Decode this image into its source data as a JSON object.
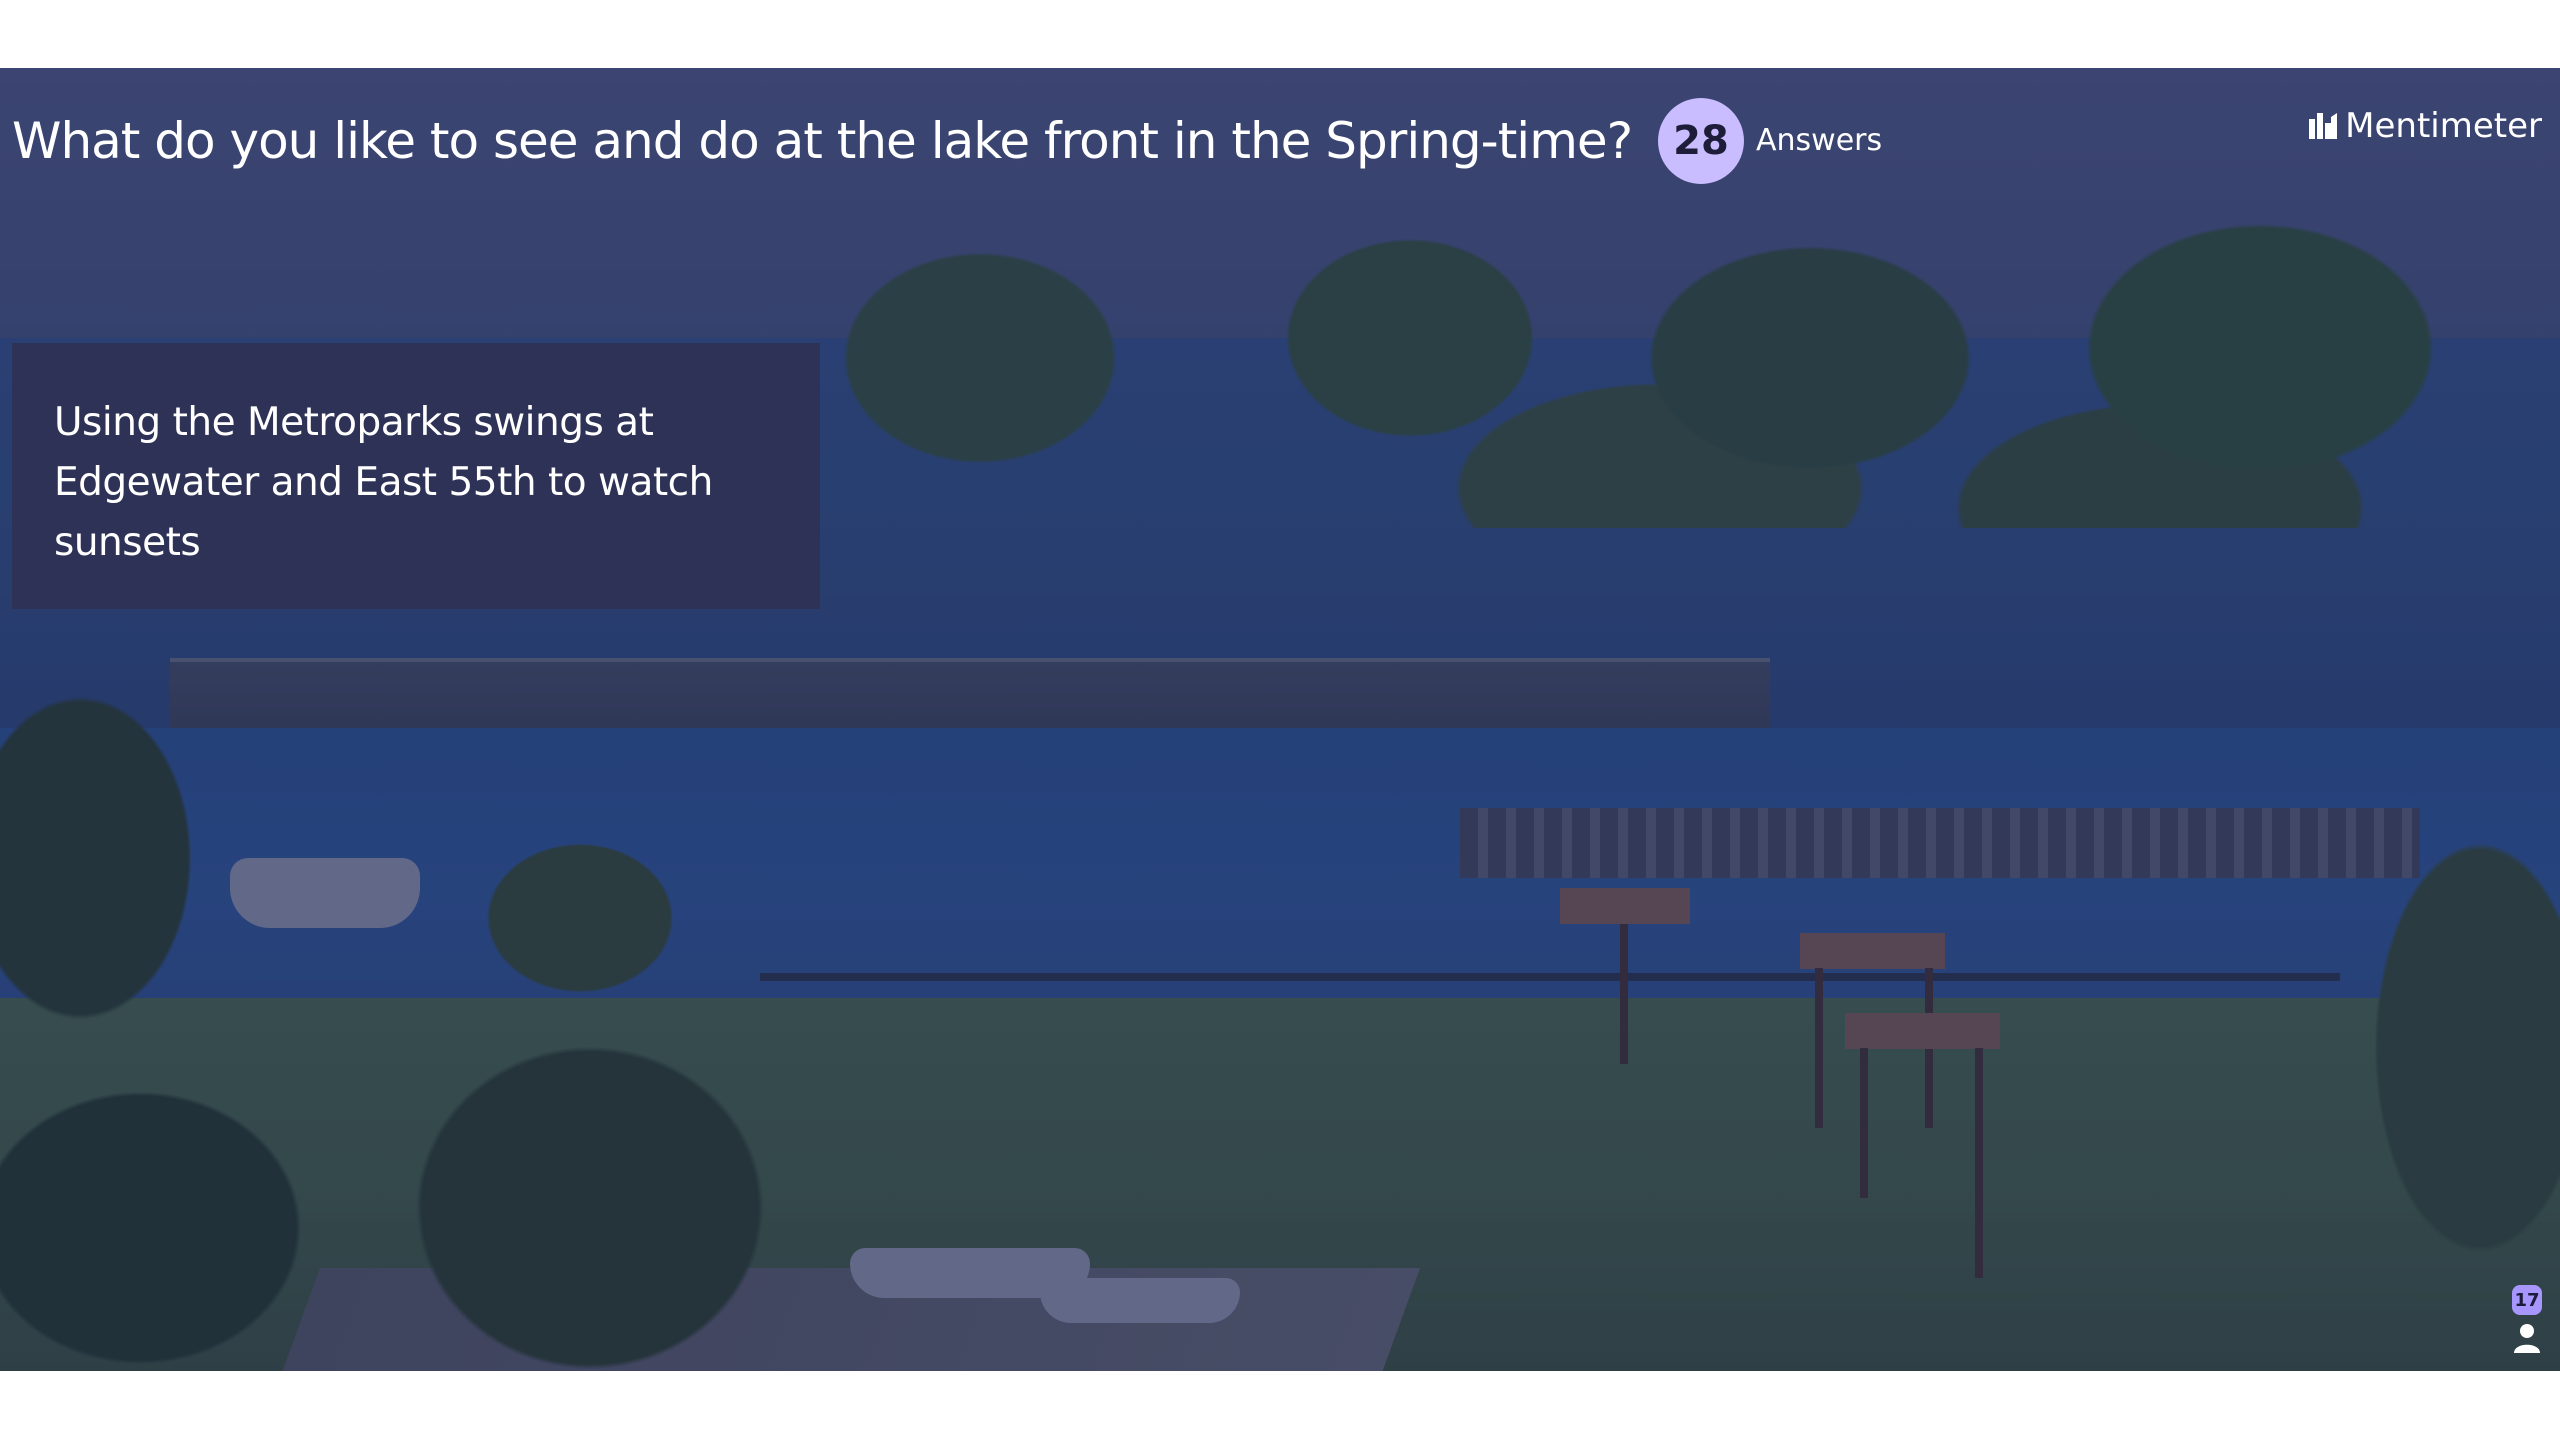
{
  "question": "What do you like to see and do at the lake front in the Spring-time?",
  "answers": {
    "count": "28",
    "label": "Answers"
  },
  "brand": {
    "name": "Mentimeter",
    "icon": "mentimeter-logo-icon"
  },
  "response": {
    "text": "Using the Metroparks swings at Edgewater and East 55th to watch sunsets"
  },
  "participants": {
    "count": "17",
    "icon": "person-icon"
  },
  "colors": {
    "badge": "#c9bcff",
    "card": "#2e3256",
    "participant_badge": "#a896ff",
    "text": "#ffffff"
  }
}
